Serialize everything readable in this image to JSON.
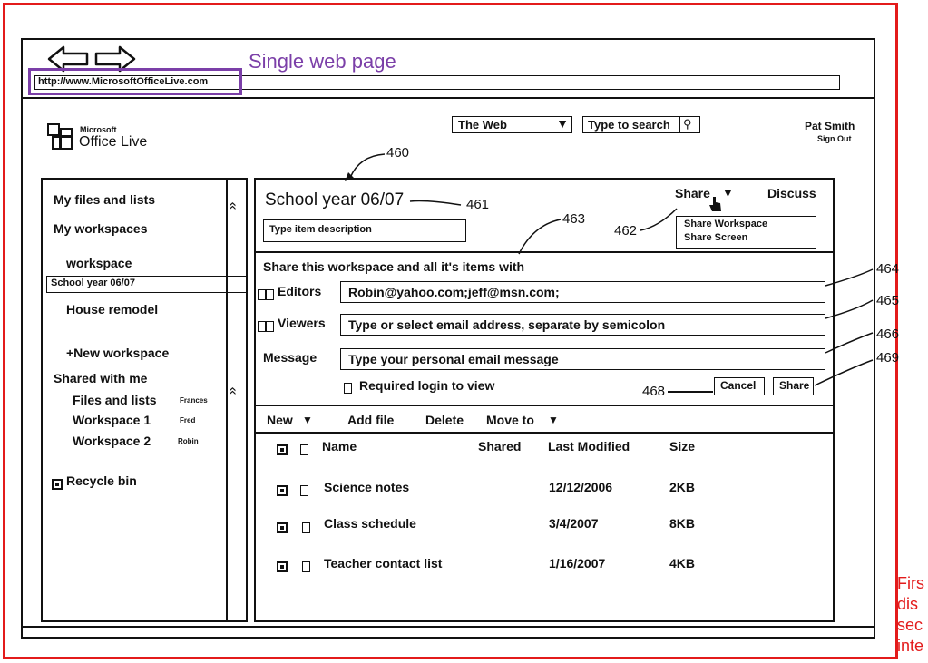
{
  "browser": {
    "url": "http://www.MicrosoftOfficeLive.com"
  },
  "callouts": {
    "single_page": "Single web page",
    "first_lines": [
      "Firs",
      "dis",
      "sec",
      "inte"
    ]
  },
  "app": {
    "brand_small": "Microsoft",
    "brand": "Office Live"
  },
  "header": {
    "scope": "The Web",
    "search_placeholder": "Type to search",
    "user": "Pat Smith",
    "sign_out": "Sign Out"
  },
  "refs": {
    "r460": "460",
    "r461": "461",
    "r462": "462",
    "r463": "463",
    "r464": "464",
    "r465": "465",
    "r466": "466",
    "r468": "468",
    "r469": "469"
  },
  "sidebar": {
    "my_files": "My files and lists",
    "my_workspaces": "My workspaces",
    "workspace": "workspace",
    "selected": "School year 06/07",
    "house": "House remodel",
    "new_ws": "+New workspace",
    "shared": "Shared with me",
    "shared_items": [
      {
        "name": "Files and lists",
        "owner": "Frances"
      },
      {
        "name": "Workspace 1",
        "owner": "Fred"
      },
      {
        "name": "Workspace 2",
        "owner": "Robin"
      }
    ],
    "recycle": "Recycle bin"
  },
  "main": {
    "title": "School year 06/07",
    "desc_placeholder": "Type item description",
    "share": "Share",
    "discuss": "Discuss",
    "share_menu": [
      "Share Workspace",
      "Share Screen"
    ]
  },
  "share_panel": {
    "intro": "Share this workspace and all it's items with",
    "editors_label": "Editors",
    "editors_value": "Robin@yahoo.com;jeff@msn.com;",
    "viewers_label": "Viewers",
    "viewers_placeholder": "Type or select email address, separate by semicolon",
    "message_label": "Message",
    "message_placeholder": "Type your personal email message",
    "required_login": "Required login to view",
    "cancel": "Cancel",
    "share": "Share"
  },
  "toolbar": {
    "new": "New",
    "add_file": "Add file",
    "delete": "Delete",
    "move_to": "Move to"
  },
  "files": {
    "columns": {
      "name": "Name",
      "shared": "Shared",
      "modified": "Last Modified",
      "size": "Size"
    },
    "rows": [
      {
        "name": "Science notes",
        "modified": "12/12/2006",
        "size": "2KB"
      },
      {
        "name": "Class schedule",
        "modified": "3/4/2007",
        "size": "8KB"
      },
      {
        "name": "Teacher contact list",
        "modified": "1/16/2007",
        "size": "4KB"
      }
    ]
  },
  "colors": {
    "frame_red": "#e31b1b",
    "callout_purple": "#7b3fa8"
  }
}
